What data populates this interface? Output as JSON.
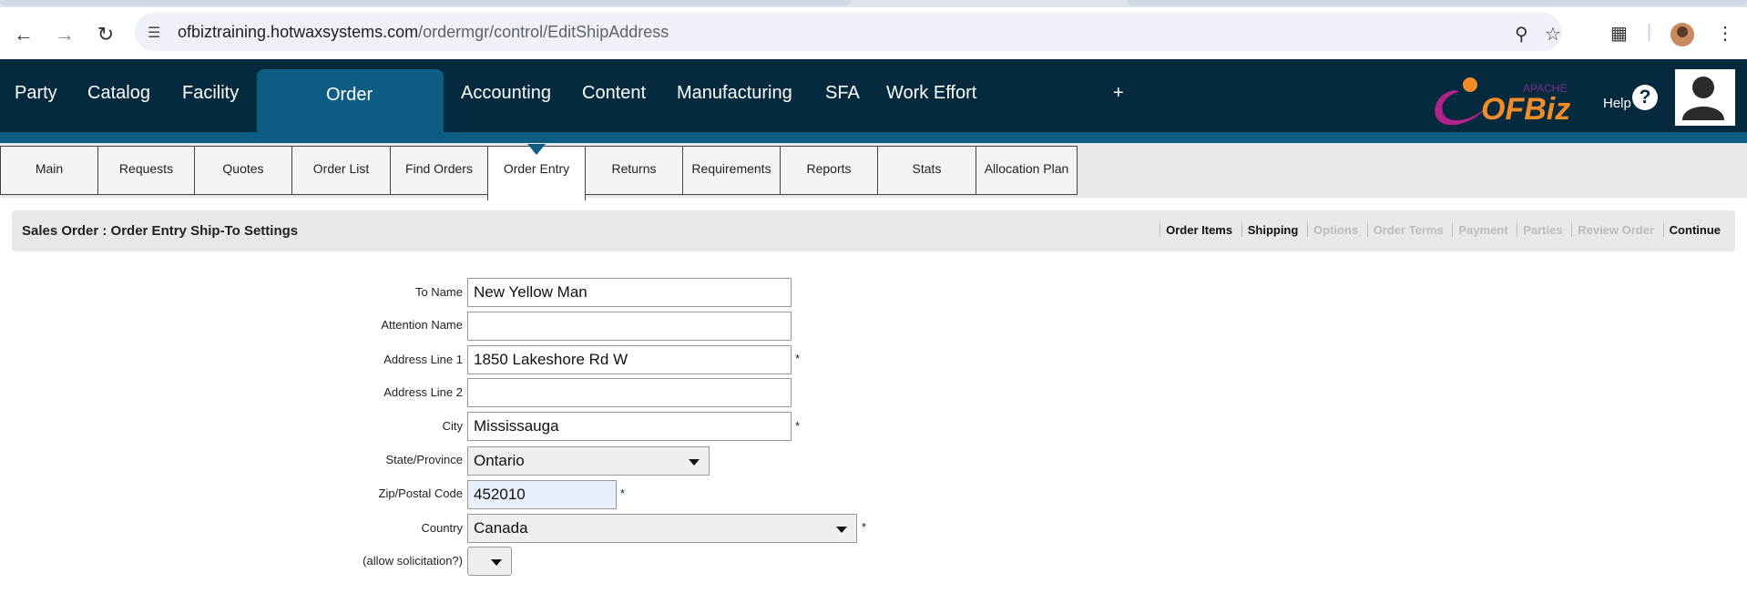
{
  "browser": {
    "url_host": "ofbiztraining.hotwaxsystems.com",
    "url_path": "/ordermgr/control/EditShipAddress"
  },
  "main_nav": {
    "items": [
      "Party",
      "Catalog",
      "Facility",
      "Order",
      "Accounting",
      "Content",
      "Manufacturing",
      "SFA",
      "Work Effort"
    ],
    "active": "Order",
    "plus": "+",
    "help": "Help",
    "help_icon": "?"
  },
  "sub_tabs": {
    "items": [
      "Main",
      "Requests",
      "Quotes",
      "Order List",
      "Find Orders",
      "Order Entry",
      "Returns",
      "Requirements",
      "Reports",
      "Stats",
      "Allocation Plan"
    ],
    "active": "Order Entry"
  },
  "section": {
    "title": "Sales Order : Order Entry Ship-To Settings",
    "steps": [
      {
        "label": "Order Items",
        "enabled": true
      },
      {
        "label": "Shipping",
        "enabled": true
      },
      {
        "label": "Options",
        "enabled": false
      },
      {
        "label": "Order Terms",
        "enabled": false
      },
      {
        "label": "Payment",
        "enabled": false
      },
      {
        "label": "Parties",
        "enabled": false
      },
      {
        "label": "Review Order",
        "enabled": false
      },
      {
        "label": "Continue",
        "enabled": true
      }
    ]
  },
  "form": {
    "to_name": {
      "label": "To Name",
      "value": "New Yellow Man"
    },
    "attention_name": {
      "label": "Attention Name",
      "value": ""
    },
    "address1": {
      "label": "Address Line 1",
      "value": "1850 Lakeshore Rd W",
      "required": "*"
    },
    "address2": {
      "label": "Address Line 2",
      "value": ""
    },
    "city": {
      "label": "City",
      "value": "Mississauga",
      "required": "*"
    },
    "state": {
      "label": "State/Province",
      "value": "Ontario"
    },
    "zip": {
      "label": "Zip/Postal Code",
      "value": "452010",
      "required": "*"
    },
    "country": {
      "label": "Country",
      "value": "Canada",
      "required": "*"
    },
    "solicitation": {
      "label": "(allow solicitation?)",
      "value": ""
    }
  },
  "colors": {
    "header_bg": "#052a3e",
    "accent": "#0d5c84"
  }
}
